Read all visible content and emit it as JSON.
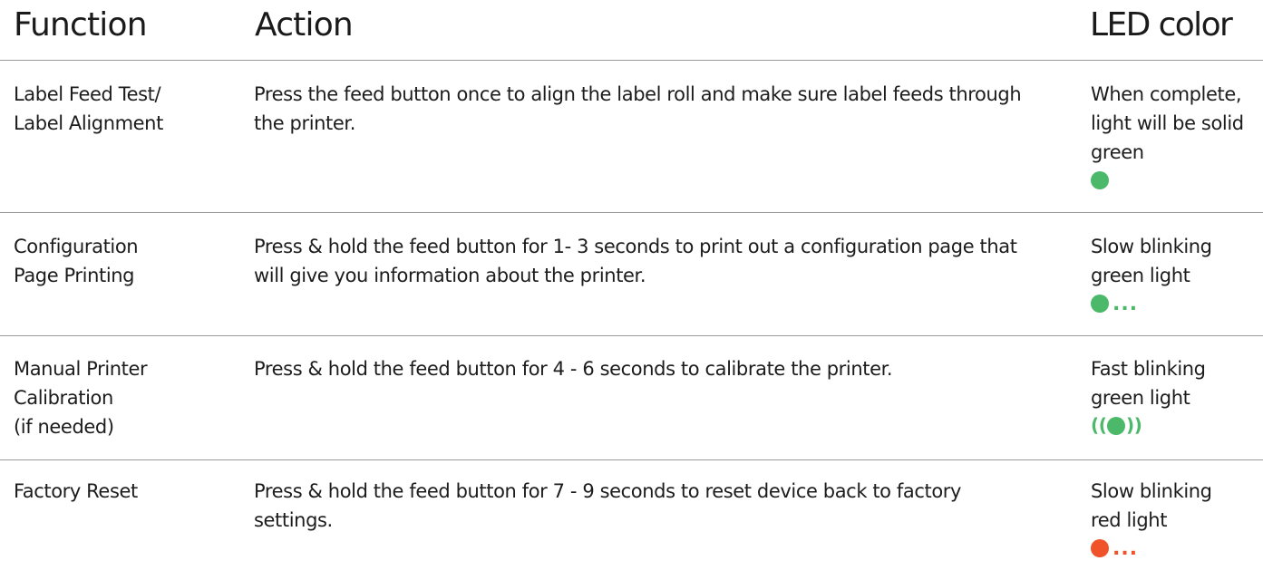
{
  "header": {
    "function": "Function",
    "action": "Action",
    "led": "LED color"
  },
  "colors": {
    "green": "#4cb86a",
    "red": "#f0522a",
    "divider": "#9a9a9a"
  },
  "rows": [
    {
      "function": "Label Feed Test/\nLabel Alignment",
      "action": "Press the feed button once to align the label roll and make sure label feeds through the printer.",
      "led": "When complete, light will be solid green",
      "indicator": "solid-green-dot-icon"
    },
    {
      "function": "Configuration\nPage Printing",
      "action": "Press & hold the feed button for 1- 3 seconds to print out a configuration page that will give you information about the printer.",
      "led": "Slow blinking green light",
      "indicator": "slow-blink-green-icon"
    },
    {
      "function": "Manual Printer\nCalibration\n(if needed)",
      "action": "Press & hold the feed button for 4 - 6 seconds to calibrate the printer.",
      "led": "Fast blinking green light",
      "indicator": "fast-blink-green-icon"
    },
    {
      "function": "Factory Reset",
      "action": "Press & hold the feed button for 7 - 9 seconds to reset device back to factory settings.",
      "led": "Slow blinking red light",
      "indicator": "slow-blink-red-icon"
    }
  ]
}
